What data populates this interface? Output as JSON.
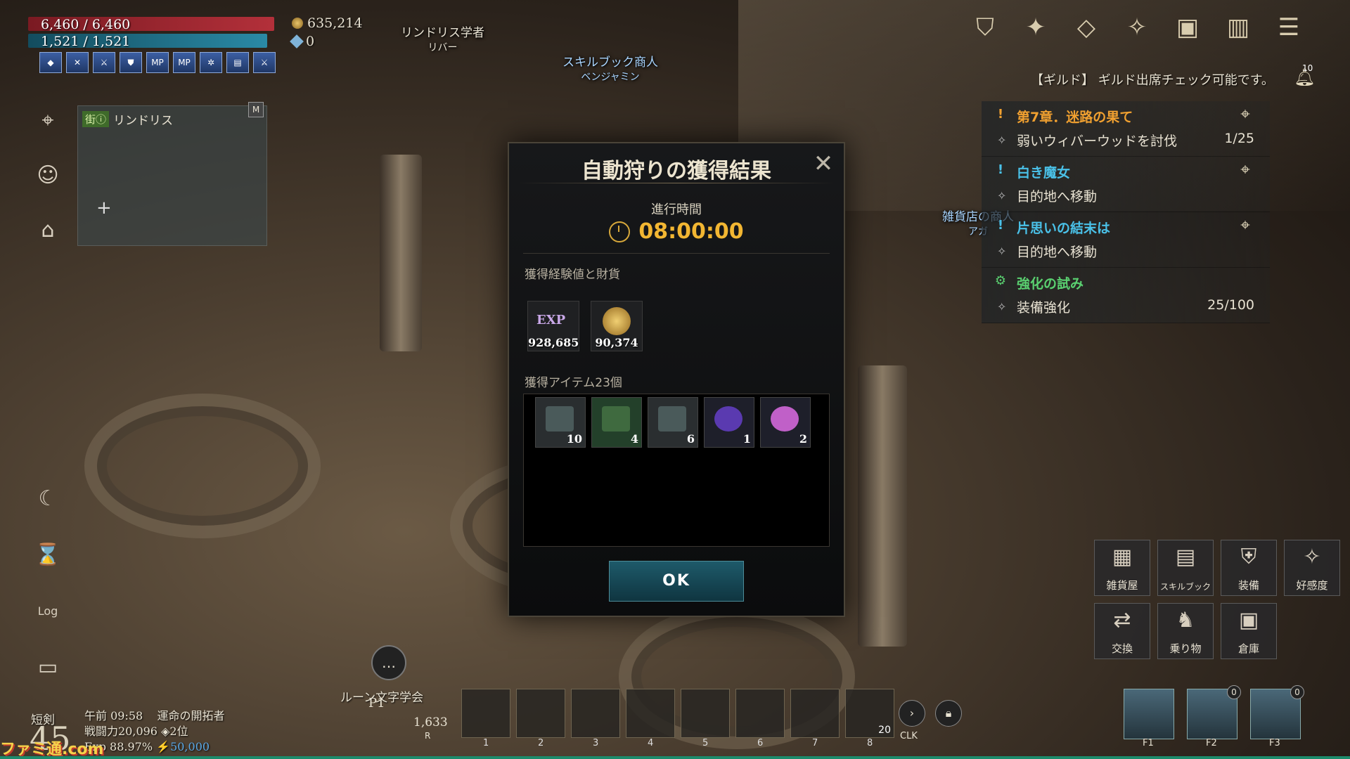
{
  "hud": {
    "hp": "6,460 / 6,460",
    "mp": "1,521 / 1,521",
    "gold": "635,214",
    "gems": "0",
    "buffs": [
      "◆",
      "✕",
      "⚔",
      "⛊",
      "MP",
      "MP",
      "✲",
      "▤",
      "⚔"
    ]
  },
  "minimap": {
    "tag": "街ⓘ",
    "location": "リンドリス",
    "map_key": "M"
  },
  "npcs": [
    {
      "title": "リンドリス学者",
      "name": "リバー"
    },
    {
      "title": "スキルブック商人",
      "name": "ベンジャミン"
    },
    {
      "title": "雑貨店の商人",
      "name": "アガ"
    }
  ],
  "guild_message": "【ギルド】 ギルド出席チェック可能です。",
  "notification_count": "10",
  "quests": [
    {
      "title": "第7章．迷路の果て",
      "sub": "弱いウィバーウッドを討伐",
      "progress": "1/25",
      "color": "#f0a030",
      "badge": "!"
    },
    {
      "title": "白き魔女",
      "sub": "目的地へ移動",
      "progress": "",
      "color": "#4ac1e8",
      "badge": "!"
    },
    {
      "title": "片思いの結末は",
      "sub": "目的地へ移動",
      "progress": "",
      "color": "#4ac1e8",
      "badge": "!"
    },
    {
      "title": "強化の試み",
      "sub": "装備強化",
      "progress": "25/100",
      "color": "#5ad070",
      "badge": "⚙"
    }
  ],
  "modal": {
    "title": "自動狩りの獲得結果",
    "elapsed_label": "進行時間",
    "elapsed": "08:00:00",
    "rewards_title": "獲得経験値と財貨",
    "exp_label": "EXP",
    "exp": "928,685",
    "gold": "90,374",
    "items_title": "獲得アイテム23個",
    "items": [
      {
        "count": "10",
        "color": "#4a5a5a"
      },
      {
        "count": "4",
        "color": "#3f6a3f"
      },
      {
        "count": "6",
        "color": "#4a5a5a"
      },
      {
        "count": "1",
        "color": "#5a3ab0"
      },
      {
        "count": "2",
        "color": "#c060c8"
      }
    ],
    "ok": "OK"
  },
  "player": {
    "class": "短剣",
    "level": "45",
    "time": "午前 09:58",
    "title": "運命の開拓者",
    "power": "戦闘力20,096",
    "rank": "2位",
    "exp": "Exp 88.97%",
    "energy": "50,000",
    "quick_label": "ルーン文字学会",
    "p1": "P1",
    "potion": "1,633",
    "potion_key": "R"
  },
  "slots": [
    {
      "num": "1",
      "count": ""
    },
    {
      "num": "2",
      "count": ""
    },
    {
      "num": "3",
      "count": ""
    },
    {
      "num": "4",
      "count": ""
    },
    {
      "num": "5",
      "count": ""
    },
    {
      "num": "6",
      "count": ""
    },
    {
      "num": "7",
      "count": ""
    },
    {
      "num": "8",
      "count": "20"
    }
  ],
  "clk": "CLK",
  "menu": [
    "雑貨屋",
    "スキルブック",
    "装備",
    "好感度",
    "交換",
    "乗り物",
    "倉庫"
  ],
  "fkeys": [
    {
      "label": "F1",
      "badge": ""
    },
    {
      "label": "F2",
      "badge": "0"
    },
    {
      "label": "F3",
      "badge": "0"
    }
  ],
  "watermark": "ファミ通.com"
}
